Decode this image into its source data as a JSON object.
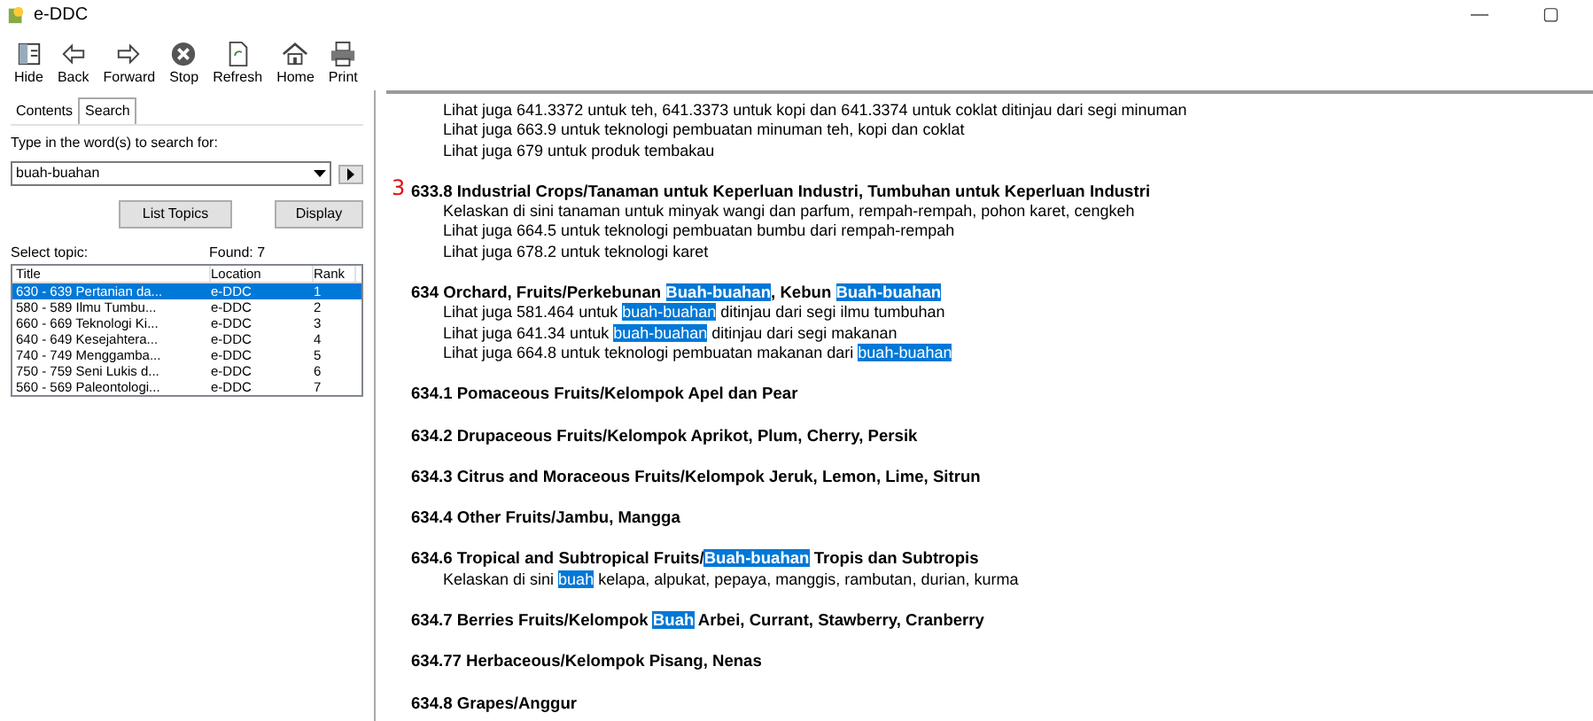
{
  "window": {
    "title": "e-DDC",
    "controls": [
      "—",
      "▢"
    ]
  },
  "toolbar": [
    {
      "label": "Hide",
      "kind": "hide"
    },
    {
      "label": "Back",
      "kind": "back"
    },
    {
      "label": "Forward",
      "kind": "forward"
    },
    {
      "label": "Stop",
      "kind": "stop"
    },
    {
      "label": "Refresh",
      "kind": "refresh"
    },
    {
      "label": "Home",
      "kind": "home"
    },
    {
      "label": "Print",
      "kind": "print"
    }
  ],
  "sidebar": {
    "tabs": [
      {
        "label": "Contents",
        "selected": false
      },
      {
        "label": "Search",
        "selected": true
      }
    ],
    "prompt": "Type in the word(s) to search for:",
    "search_value": "buah-buahan",
    "buttons": [
      "List Topics",
      "Display"
    ],
    "select_label": "Select topic:",
    "found": "Found: 7",
    "columns": [
      "Title",
      "Location",
      "Rank"
    ],
    "rows": [
      {
        "cells": [
          "630 - 639 Pertanian da...",
          "e-DDC",
          "1"
        ],
        "selected": true
      },
      {
        "cells": [
          "580 - 589 Ilmu Tumbu...",
          "e-DDC",
          "2"
        ],
        "selected": false
      },
      {
        "cells": [
          "660 - 669 Teknologi Ki...",
          "e-DDC",
          "3"
        ],
        "selected": false
      },
      {
        "cells": [
          "640 - 649 Kesejahtera...",
          "e-DDC",
          "4"
        ],
        "selected": false
      },
      {
        "cells": [
          "740 - 749 Menggamba...",
          "e-DDC",
          "5"
        ],
        "selected": false
      },
      {
        "cells": [
          "750 - 759 Seni Lukis d...",
          "e-DDC",
          "6"
        ],
        "selected": false
      },
      {
        "cells": [
          "560 - 569 Paleontologi...",
          "e-DDC",
          "7"
        ],
        "selected": false
      }
    ]
  },
  "content": {
    "entries": [
      {
        "lines": [
          [
            {
              "text": "Lihat juga 641.3372 untuk teh, 641.3373 untuk kopi dan 641.3374 untuk coklat ditinjau dari segi minuman",
              "highlight": false
            }
          ],
          [
            {
              "text": "Lihat juga 663.9 untuk teknologi pembuatan minuman teh, kopi dan coklat",
              "highlight": false
            }
          ],
          [
            {
              "text": "Lihat juga 679 untuk produk tembakau",
              "highlight": false
            }
          ]
        ]
      },
      {
        "mark": "3",
        "heading": [
          {
            "text": "633.8 Industrial Crops/Tanaman untuk Keperluan Industri, Tumbuhan untuk Keperluan Industri",
            "highlight": false
          }
        ],
        "lines": [
          [
            {
              "text": "Kelaskan di sini tanaman untuk minyak wangi dan parfum, rempah-rempah, pohon karet, cengkeh",
              "highlight": false
            }
          ],
          [
            {
              "text": "Lihat juga 664.5 untuk teknologi pembuatan bumbu dari rempah-rempah",
              "highlight": false
            }
          ],
          [
            {
              "text": "Lihat juga 678.2 untuk teknologi karet",
              "highlight": false
            }
          ]
        ]
      },
      {
        "heading": [
          {
            "text": "634 Orchard, Fruits/Perkebunan ",
            "highlight": false
          },
          {
            "text": "Buah-buahan",
            "highlight": true
          },
          {
            "text": ", Kebun ",
            "highlight": false
          },
          {
            "text": "Buah-buahan",
            "highlight": true
          }
        ],
        "lines": [
          [
            {
              "text": "Lihat juga 581.464 untuk ",
              "highlight": false
            },
            {
              "text": "buah-buahan",
              "highlight": true
            },
            {
              "text": " ditinjau dari segi ilmu tumbuhan",
              "highlight": false
            }
          ],
          [
            {
              "text": "Lihat juga 641.34 untuk ",
              "highlight": false
            },
            {
              "text": "buah-buahan",
              "highlight": true
            },
            {
              "text": " ditinjau dari segi makanan",
              "highlight": false
            }
          ],
          [
            {
              "text": "Lihat juga 664.8 untuk teknologi pembuatan makanan dari ",
              "highlight": false
            },
            {
              "text": "buah-buahan",
              "highlight": true
            }
          ]
        ]
      },
      {
        "heading": [
          {
            "text": "634.1 Pomaceous Fruits/Kelompok Apel dan Pear",
            "highlight": false
          }
        ]
      },
      {
        "heading": [
          {
            "text": "634.2 Drupaceous Fruits/Kelompok Aprikot, Plum, Cherry, Persik",
            "highlight": false
          }
        ]
      },
      {
        "heading": [
          {
            "text": "634.3 Citrus and Moraceous Fruits/Kelompok Jeruk, Lemon, Lime, Sitrun",
            "highlight": false
          }
        ]
      },
      {
        "heading": [
          {
            "text": "634.4 Other Fruits/Jambu, Mangga",
            "highlight": false
          }
        ]
      },
      {
        "heading": [
          {
            "text": "634.6 Tropical and Subtropical Fruits/",
            "highlight": false
          },
          {
            "text": "Buah-buahan",
            "highlight": true
          },
          {
            "text": " Tropis dan Subtropis",
            "highlight": false
          }
        ],
        "lines": [
          [
            {
              "text": "Kelaskan di sini ",
              "highlight": false
            },
            {
              "text": "buah",
              "highlight": true
            },
            {
              "text": " kelapa, alpukat, pepaya, manggis, rambutan, durian, kurma",
              "highlight": false
            }
          ]
        ]
      },
      {
        "heading": [
          {
            "text": "634.7 Berries Fruits/Kelompok ",
            "highlight": false
          },
          {
            "text": "Buah",
            "highlight": true
          },
          {
            "text": " Arbei, Currant, Stawberry, Cranberry",
            "highlight": false
          }
        ]
      },
      {
        "heading": [
          {
            "text": "634.77 Herbaceous/Kelompok Pisang, Nenas",
            "highlight": false
          }
        ]
      },
      {
        "heading": [
          {
            "text": "634.8 Grapes/Anggur",
            "highlight": false
          }
        ]
      }
    ]
  }
}
